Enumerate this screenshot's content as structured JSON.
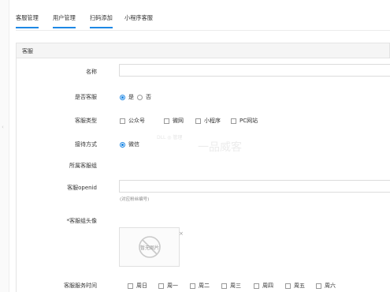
{
  "tabs": [
    {
      "label": "客服管理",
      "active": true
    },
    {
      "label": "用户管理",
      "active": true
    },
    {
      "label": "扫码添加",
      "active": true
    },
    {
      "label": "小程序客服",
      "active": false
    }
  ],
  "panel": {
    "title": "客服"
  },
  "form": {
    "name_label": "名称",
    "name_value": "",
    "is_service_label": "是否客服",
    "is_service_options": [
      "是",
      "否"
    ],
    "is_service_selected": "是",
    "service_type_label": "客服类型",
    "service_type_options": [
      "公众号",
      "微网",
      "小程序",
      "PC网站"
    ],
    "reception_label": "接待方式",
    "reception_selected": "微信",
    "group_label": "所属客服组",
    "openid_label": "客服openid",
    "openid_hint": "(对应粉丝编号)",
    "avatar_label": "*客服组头像",
    "avatar_placeholder": "暂无图片",
    "avatar_close": "×",
    "time_label": "客服服务时间",
    "weekdays": [
      "周日",
      "周一",
      "周二",
      "周三",
      "周四",
      "周五",
      "周六"
    ]
  },
  "watermark": {
    "small": "DLL ◎ 管理",
    "logo": "一品威客"
  },
  "colors": {
    "accent": "#1e88e5",
    "border": "#dcdcdc",
    "header_bg": "#f5f5f5"
  }
}
